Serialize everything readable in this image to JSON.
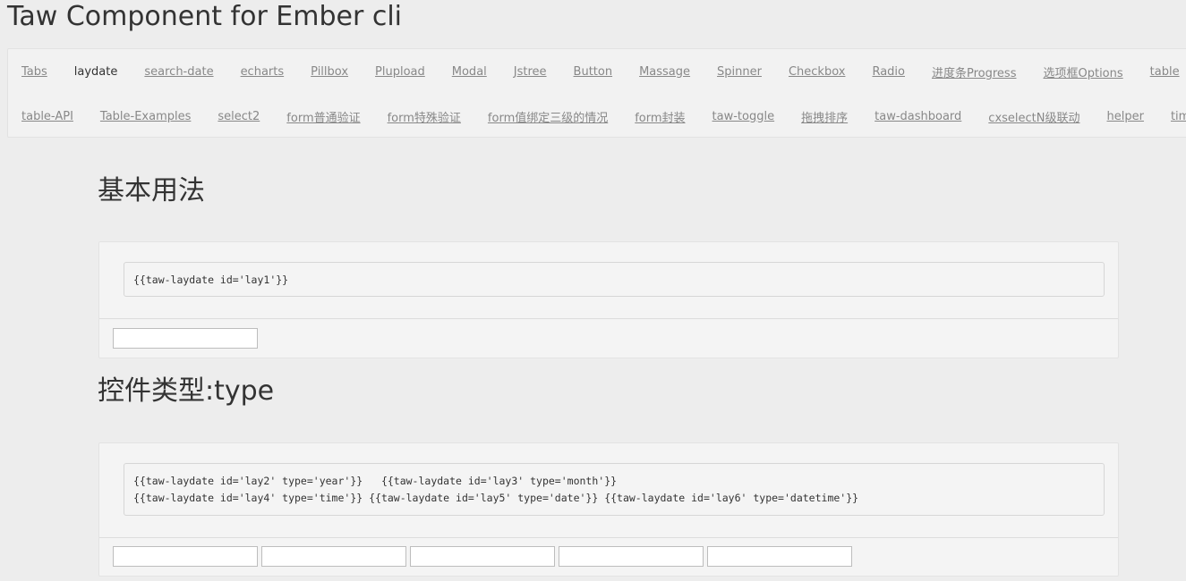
{
  "header": {
    "title": "Taw Component for Ember cli"
  },
  "nav": {
    "row1": [
      {
        "label": "Tabs",
        "active": false
      },
      {
        "label": "laydate",
        "active": true
      },
      {
        "label": "search-date",
        "active": false
      },
      {
        "label": "echarts",
        "active": false
      },
      {
        "label": "Pillbox",
        "active": false
      },
      {
        "label": "Plupload",
        "active": false
      },
      {
        "label": "Modal",
        "active": false
      },
      {
        "label": "Jstree",
        "active": false
      },
      {
        "label": "Button",
        "active": false
      },
      {
        "label": "Massage",
        "active": false
      },
      {
        "label": "Spinner",
        "active": false
      },
      {
        "label": "Checkbox",
        "active": false
      },
      {
        "label": "Radio",
        "active": false
      },
      {
        "label": "进度条Progress",
        "active": false
      },
      {
        "label": "选项框Options",
        "active": false
      },
      {
        "label": "table",
        "active": false
      }
    ],
    "row2": [
      {
        "label": "table-API",
        "active": false
      },
      {
        "label": "Table-Examples",
        "active": false
      },
      {
        "label": "select2",
        "active": false
      },
      {
        "label": "form普通验证",
        "active": false
      },
      {
        "label": "form特殊验证",
        "active": false
      },
      {
        "label": "form值绑定三级的情况",
        "active": false
      },
      {
        "label": "form封装",
        "active": false
      },
      {
        "label": "taw-toggle",
        "active": false
      },
      {
        "label": "拖拽排序",
        "active": false
      },
      {
        "label": "taw-dashboard",
        "active": false
      },
      {
        "label": "cxselectN级联动",
        "active": false
      },
      {
        "label": "helper",
        "active": false
      },
      {
        "label": "timechange",
        "active": false
      }
    ]
  },
  "sections": [
    {
      "heading": "基本用法",
      "code_lines": [
        "{{taw-laydate id='lay1'}}"
      ],
      "inputs": [
        {
          "value": ""
        }
      ]
    },
    {
      "heading": "控件类型:type",
      "code_lines": [
        "{{taw-laydate id='lay2' type='year'}}   {{taw-laydate id='lay3' type='month'}}",
        "{{taw-laydate id='lay4' type='time'}} {{taw-laydate id='lay5' type='date'}} {{taw-laydate id='lay6' type='datetime'}}"
      ],
      "inputs": [
        {
          "value": ""
        },
        {
          "value": ""
        },
        {
          "value": ""
        },
        {
          "value": ""
        },
        {
          "value": ""
        }
      ]
    }
  ]
}
